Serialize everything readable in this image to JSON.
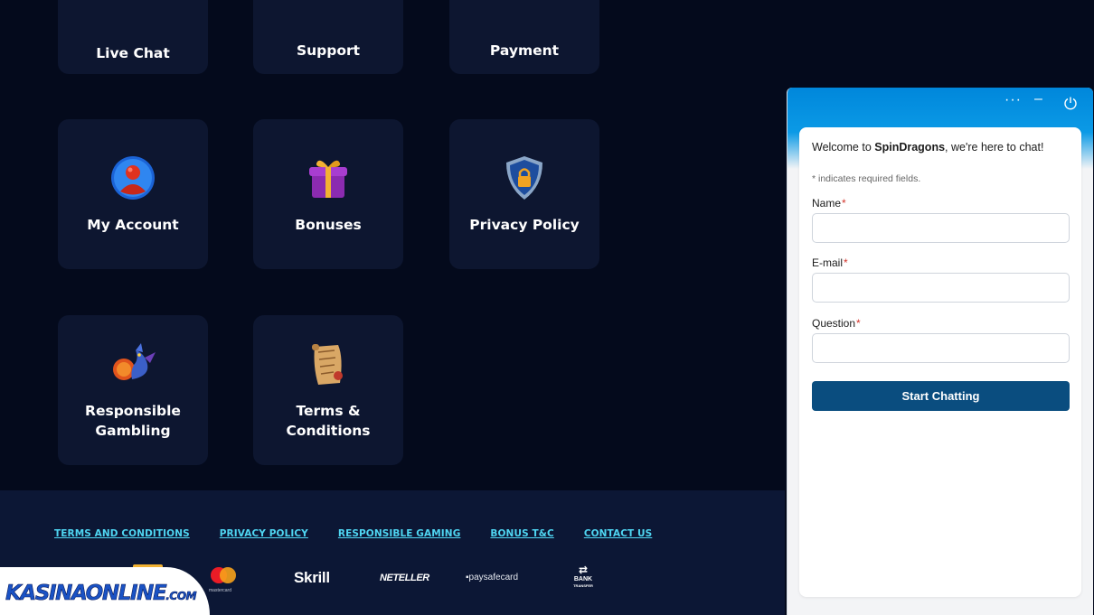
{
  "tiles": [
    {
      "label": "Live Chat",
      "icon": "chat-icon"
    },
    {
      "label": "Support",
      "icon": "support-icon"
    },
    {
      "label": "Payment",
      "icon": "payment-icon"
    },
    {
      "label": "My Account",
      "icon": "account-icon"
    },
    {
      "label": "Bonuses",
      "icon": "gift-icon"
    },
    {
      "label": "Privacy Policy",
      "icon": "shield-lock-icon"
    },
    {
      "label": "Responsible\nGambling",
      "icon": "dragon-icon"
    },
    {
      "label": "Terms &\nConditions",
      "icon": "scroll-icon"
    }
  ],
  "footer": {
    "links": [
      "TERMS AND CONDITIONS",
      "PRIVACY POLICY",
      "RESPONSIBLE GAMING",
      "BONUS T&C",
      "CONTACT US"
    ],
    "payments": {
      "mastercard": "mastercard",
      "skrill": "Skrill",
      "neteller": "NETELLER",
      "paysafecard": "paysafecard",
      "bank_line1": "BANK",
      "bank_line2": "TRANSFER"
    }
  },
  "brand": {
    "name": "KASINAONLINE",
    "suffix": ".COM"
  },
  "chat": {
    "welcome_prefix": "Welcome to ",
    "brand": "SpinDragons",
    "welcome_suffix": ", we're here to chat!",
    "required_note": "* indicates required fields.",
    "fields": [
      {
        "label": "Name",
        "value": ""
      },
      {
        "label": "E-mail",
        "value": ""
      },
      {
        "label": "Question",
        "value": ""
      }
    ],
    "required_mark": "*",
    "submit_label": "Start Chatting",
    "controls": {
      "more": "more-icon",
      "minimize": "minimize-icon",
      "power": "power-icon"
    }
  },
  "colors": {
    "page_bg": "#040a1c",
    "tile_bg": "#0d1630",
    "footer_bg": "#0c1735",
    "link": "#4fd6f2",
    "chat_header": "#0087db",
    "chat_button": "#0a4d7f",
    "required": "#d3342b"
  }
}
